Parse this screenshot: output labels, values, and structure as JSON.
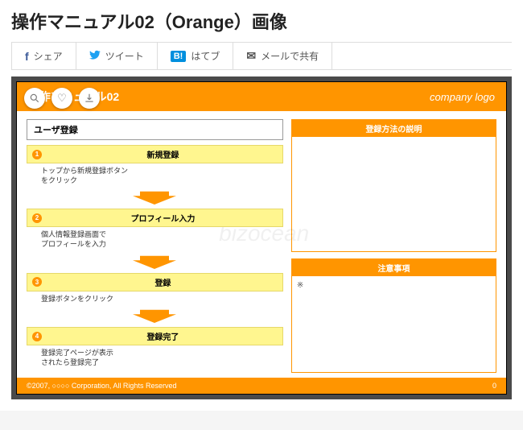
{
  "page": {
    "title": "操作マニュアル02（Orange）画像"
  },
  "share": {
    "facebook": "シェア",
    "twitter": "ツイート",
    "hatena_glyph": "B!",
    "hatena": "はてブ",
    "mail": "メールで共有"
  },
  "toolbar": {
    "zoom": "⦻",
    "like": "♡",
    "download": "⇩"
  },
  "slide": {
    "header_title": "操作マニュアル02",
    "header_logo": "company logo",
    "section_title": "ユーザ登録",
    "steps": [
      {
        "num": "1",
        "label": "新規登録",
        "body": "トップから新規登録ボタン\nをクリック"
      },
      {
        "num": "2",
        "label": "プロフィール入力",
        "body": "個人情報登録画面で\nプロフィールを入力"
      },
      {
        "num": "3",
        "label": "登録",
        "body": "登録ボタンをクリック"
      },
      {
        "num": "4",
        "label": "登録完了",
        "body": "登録完了ページが表示\nされたら登録完了"
      }
    ],
    "info1_title": "登録方法の説明",
    "info1_body": "",
    "info2_title": "注意事項",
    "info2_body": "※",
    "footer_left": "©2007, ○○○○ Corporation, All Rights Reserved",
    "footer_right": "0",
    "watermark": "bizocean"
  }
}
